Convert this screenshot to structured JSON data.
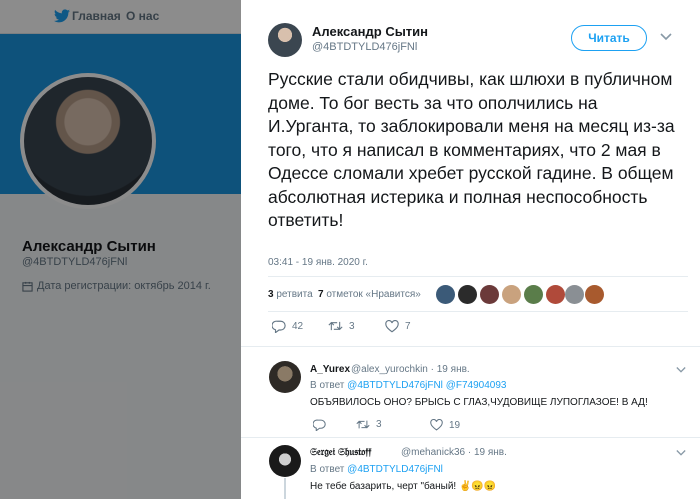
{
  "nav": {
    "home_label": "Главная",
    "about_label": "О нас"
  },
  "profile": {
    "name": "Александр Сытин",
    "handle": "@4BTDTYLD476jFNl",
    "joined": "Дата регистрации: октябрь 2014 г."
  },
  "tweet": {
    "author_name": "Александр Сытин",
    "author_handle": "@4BTDTYLD476jFNl",
    "follow_label": "Читать",
    "text": "Русские стали обидчивы, как шлюхи в публичном доме. То бог весть за что ополчились на И.Урганта, то заблокировали меня на месяц из-за того, что я написал в комментариях, что 2 мая в Одессе сломали хребет русской гадине. В общем абсолютная истерика и полная неспособность ответить!",
    "timestamp": "03:41 - 19 янв. 2020 г.",
    "retweets_count": "3",
    "retweets_label": "ретвита",
    "likes_count": "7",
    "likes_label": "отметок «Нравится»",
    "actions": {
      "replies": "42",
      "retweets": "3",
      "likes": "7"
    },
    "liker_colors": [
      "#3b5a78",
      "#2b2b2b",
      "#6b3a3a",
      "#c9a27e",
      "#5a7d4a",
      "#b04a3a",
      "#8a8f94",
      "#a85a2e"
    ]
  },
  "replies": [
    {
      "name": "A_Yurex",
      "handle": "@alex_yurochkin",
      "date": "19 янв.",
      "reply_prefix": "В ответ",
      "mention1": "@4BTDTYLD476jFNl",
      "mention2": "@F74904093",
      "text": "ОБЪЯВИЛОСЬ ОНО? БРЫСЬ С ГЛАЗ,ЧУДОВИЩЕ ЛУПОГЛАЗОЕ! В АД!",
      "actions": {
        "replies": "",
        "retweets": "3",
        "likes": "19"
      }
    },
    {
      "name": "𝔖𝔢𝔯𝔤𝔢𝔦 𝔖𝔥𝔲𝔰𝔱𝔬𝔣𝔣",
      "handle": "@mehanick36",
      "date": "19 янв.",
      "reply_prefix": "В ответ",
      "mention1": "@4BTDTYLD476jFNl",
      "text": "Не тебе базарить, черт \"баный! ✌️😠😠"
    }
  ]
}
